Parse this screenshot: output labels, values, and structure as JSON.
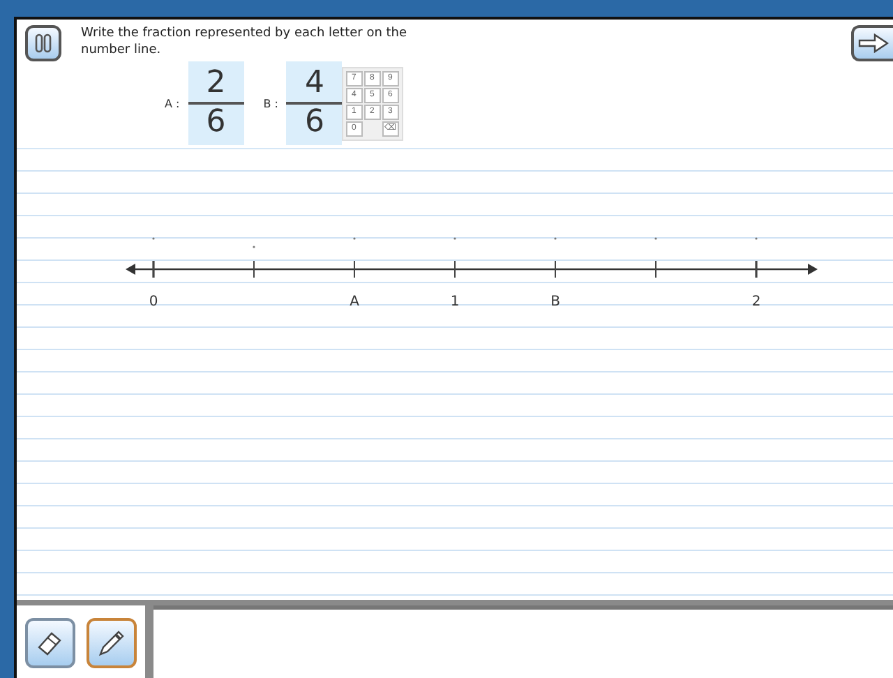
{
  "question": "Write the fraction represented by each letter on the number line.",
  "fractions": [
    {
      "label": "A :",
      "numerator": "2",
      "denominator": "6"
    },
    {
      "label": "B :",
      "numerator": "4",
      "denominator": "6"
    }
  ],
  "keypad": [
    {
      "key": "7"
    },
    {
      "key": "8"
    },
    {
      "key": "9"
    },
    {
      "key": "4"
    },
    {
      "key": "5"
    },
    {
      "key": "6"
    },
    {
      "key": "1"
    },
    {
      "key": "2"
    },
    {
      "key": "3"
    },
    {
      "key": "0"
    },
    {
      "key": "⌫",
      "kind": "delete"
    }
  ],
  "number_line": {
    "ticks": [
      {
        "kind": "labelled",
        "label": "0"
      },
      {
        "kind": "plain"
      },
      {
        "kind": "labelled",
        "label": "A"
      },
      {
        "kind": "labelled",
        "label": "1"
      },
      {
        "kind": "labelled",
        "label": "B"
      },
      {
        "kind": "plain"
      },
      {
        "kind": "labelled",
        "label": "2"
      }
    ]
  },
  "tools": [
    {
      "kind": "eraser",
      "selected": false
    },
    {
      "kind": "pen",
      "selected": true
    }
  ]
}
